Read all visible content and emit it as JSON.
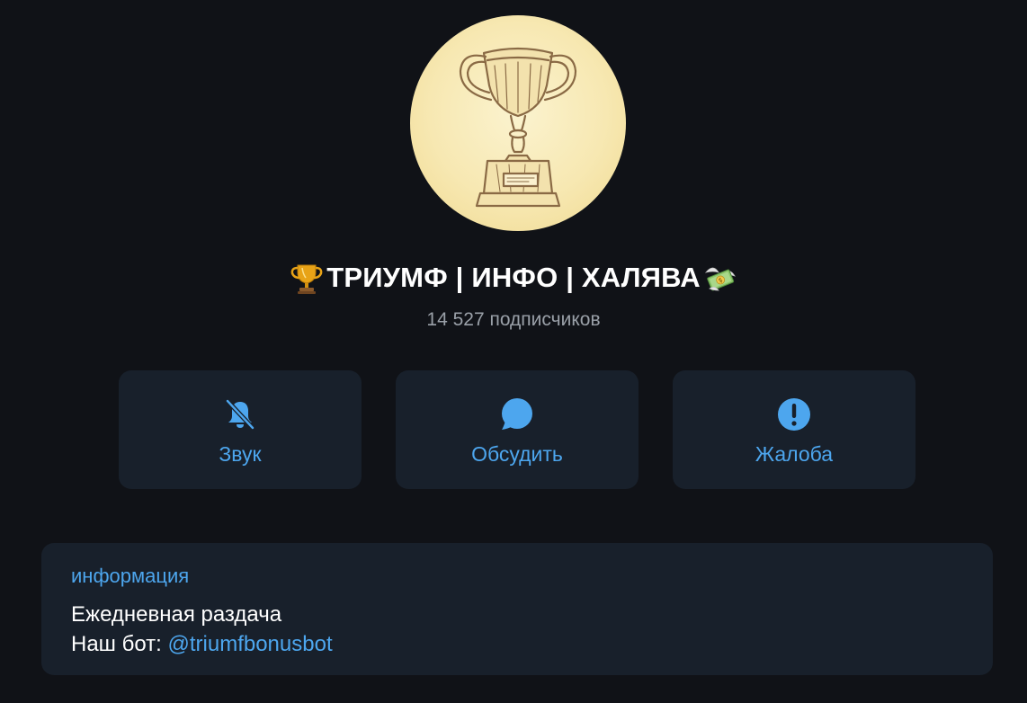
{
  "channel": {
    "avatar_icon": "trophy-sketch",
    "title": "ТРИУМФ | ИНФО | ХАЛЯВА",
    "title_prefix_emoji": "trophy-emoji",
    "title_suffix_emoji": "money-with-wings-emoji",
    "subscribers": "14 527 подписчиков"
  },
  "actions": [
    {
      "label": "Звук",
      "icon": "bell-slash-icon"
    },
    {
      "label": "Обсудить",
      "icon": "chat-bubble-icon"
    },
    {
      "label": "Жалоба",
      "icon": "exclamation-circle-icon"
    }
  ],
  "info": {
    "heading": "информация",
    "line1": "Ежедневная раздача",
    "line2_prefix": "Наш бот: ",
    "line2_link": "@triumfbonusbot"
  },
  "colors": {
    "background": "#101217",
    "card": "#18202b",
    "accent": "#4da6ee",
    "muted_text": "#9aa0a8"
  }
}
